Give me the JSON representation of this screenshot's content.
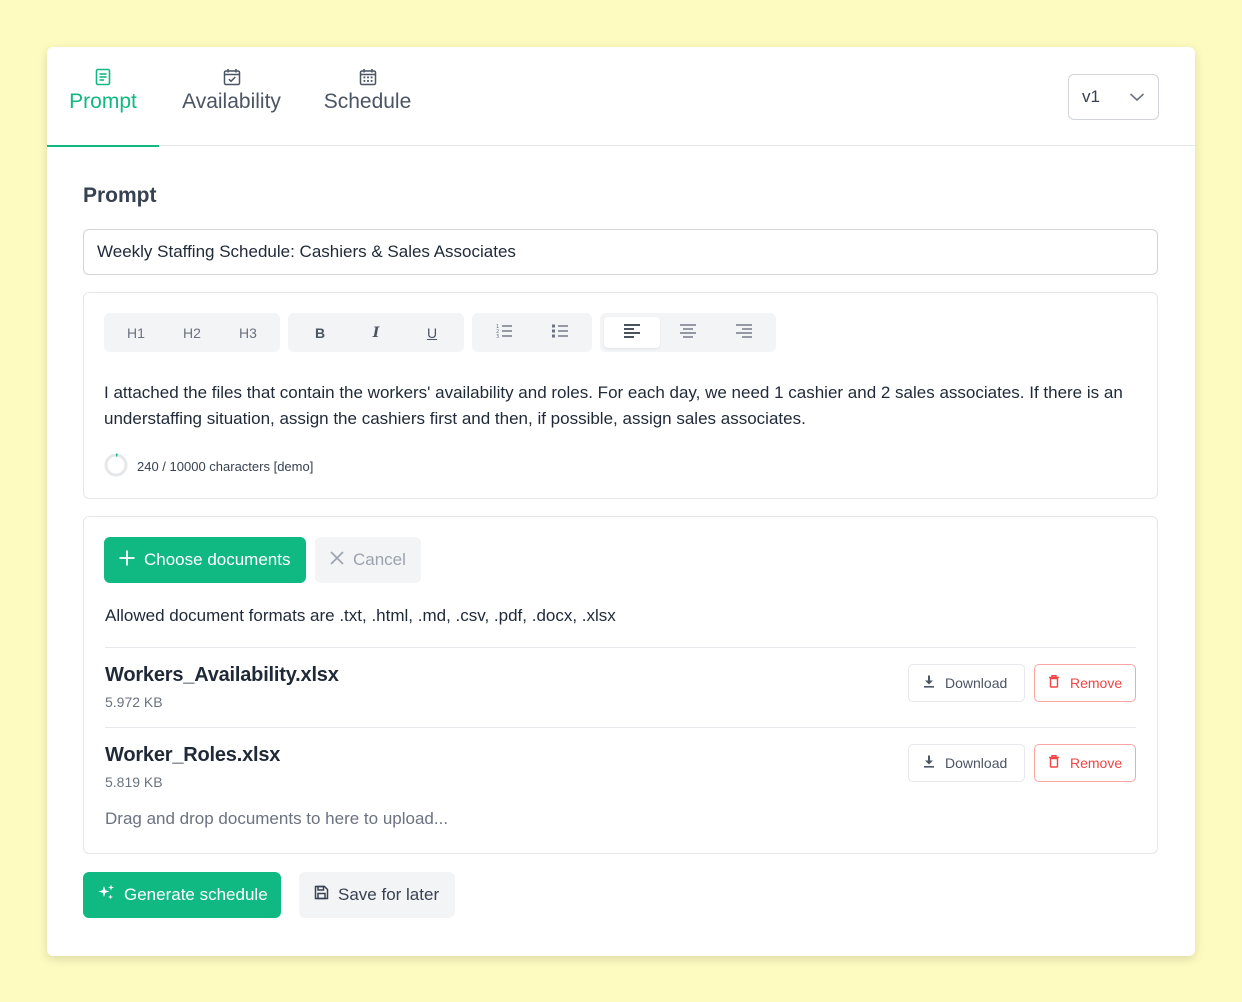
{
  "tabs": [
    {
      "label": "Prompt",
      "icon": "document-text-icon",
      "active": true
    },
    {
      "label": "Availability",
      "icon": "calendar-check-icon",
      "active": false
    },
    {
      "label": "Schedule",
      "icon": "calendar-grid-icon",
      "active": false
    }
  ],
  "version": {
    "selected": "v1"
  },
  "prompt": {
    "section_title": "Prompt",
    "title_value": "Weekly Staffing Schedule: Cashiers & Sales Associates",
    "toolbar": {
      "headings": [
        "H1",
        "H2",
        "H3"
      ],
      "format": [
        "B",
        "I",
        "U"
      ]
    },
    "body": "I attached the files that contain the workers' availability and roles. For each day, we need 1 cashier and 2 sales associates. If there is an understaffing situation, assign the cashiers first and then, if possible, assign sales associates.",
    "char_count": "240 / 10000 characters [demo]",
    "char_count_fraction": 0.024
  },
  "upload": {
    "choose_label": "Choose documents",
    "cancel_label": "Cancel",
    "allowed_text": "Allowed document formats are .txt, .html, .md, .csv, .pdf, .docx, .xlsx",
    "files": [
      {
        "name": "Workers_Availability.xlsx",
        "size": "5.972 KB",
        "download_label": "Download",
        "remove_label": "Remove"
      },
      {
        "name": "Worker_Roles.xlsx",
        "size": "5.819 KB",
        "download_label": "Download",
        "remove_label": "Remove"
      }
    ],
    "dropzone_text": "Drag and drop documents to here to upload..."
  },
  "actions": {
    "generate_label": "Generate schedule",
    "save_label": "Save for later"
  },
  "colors": {
    "accent": "#10b981",
    "background": "#fefbc0",
    "danger": "#ef4444"
  }
}
